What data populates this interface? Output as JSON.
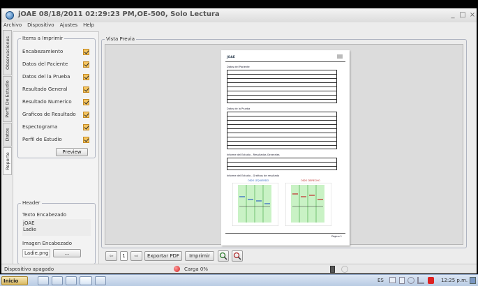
{
  "window": {
    "title": "jOAE     08/18/2011 02:29:23 PM,OE-500, Solo Lectura",
    "minimize": "_",
    "maximize": "□",
    "close": "×"
  },
  "menu": [
    "Archivo",
    "Dispositivo",
    "Ajustes",
    "Help"
  ],
  "vertical_tabs": [
    "Observaciones",
    "Perfil De Estudio",
    "Datos",
    "Reporte"
  ],
  "active_tab": "Reporte",
  "items_panel": {
    "legend": "Items a Imprimir",
    "items": [
      {
        "label": "Encabezamiento",
        "checked": true
      },
      {
        "label": "Datos del Paciente",
        "checked": true
      },
      {
        "label": "Datos del la Prueba",
        "checked": true
      },
      {
        "label": "Resultado General",
        "checked": true
      },
      {
        "label": "Resultado Numerico",
        "checked": true
      },
      {
        "label": "Graficos de Resultado",
        "checked": true
      },
      {
        "label": "Espectograma",
        "checked": true
      },
      {
        "label": "Perfil de Estudio",
        "checked": true
      }
    ],
    "preview_button": "Preview"
  },
  "header_panel": {
    "legend": "Header",
    "texto_label": "Texto Encabezado",
    "texto_lines": [
      "jOAE",
      "Ladie"
    ],
    "imagen_label": "Imagen Encabezado",
    "imagen_value": "Ladie.png",
    "browse_button": "..."
  },
  "vista_previa": {
    "legend": "Vista Previa",
    "page_number": "1",
    "export_button": "Exportar PDF",
    "print_button": "Imprimir",
    "paper": {
      "logo": "jOAE",
      "section1": "Datos del Paciente",
      "section2": "Datos de la Prueba",
      "section3": "Informe del Estudio - Resultados Generales",
      "section4": "Informe del Estudio - Graficos de resultado",
      "chart_left": "OIDO IZQUIERDO",
      "chart_right": "OIDO DERECHO",
      "footer": "Página 1"
    }
  },
  "status": {
    "device": "Dispositivo apagado",
    "carga": "Carga  0%"
  },
  "taskbar": {
    "start": "Inicio",
    "lang": "ES",
    "time": "12:25 p.m."
  }
}
